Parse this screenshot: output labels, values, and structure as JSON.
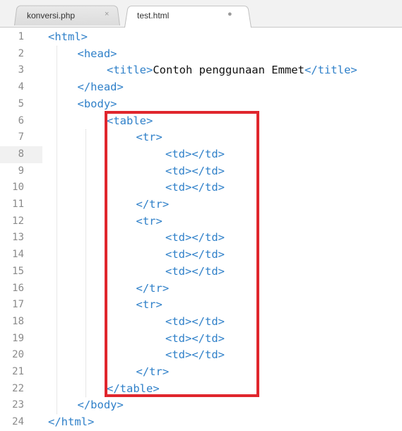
{
  "tabs": [
    {
      "label": "konversi.php",
      "control": "×",
      "active": false
    },
    {
      "label": "test.html",
      "control": "●",
      "active": true
    }
  ],
  "lines": [
    {
      "n": "1",
      "indent": 0,
      "code": "<html>",
      "text": ""
    },
    {
      "n": "2",
      "indent": 1,
      "code": "<head>",
      "text": ""
    },
    {
      "n": "3",
      "indent": 2,
      "code": "<title>",
      "text": "Contoh penggunaan Emmet",
      "close": "</title>"
    },
    {
      "n": "4",
      "indent": 1,
      "code": "</head>",
      "text": ""
    },
    {
      "n": "5",
      "indent": 1,
      "code": "<body>",
      "text": ""
    },
    {
      "n": "6",
      "indent": 2,
      "code": "<table>",
      "text": ""
    },
    {
      "n": "7",
      "indent": 3,
      "code": "<tr>",
      "text": ""
    },
    {
      "n": "8",
      "indent": 4,
      "code": "<td></td>",
      "text": ""
    },
    {
      "n": "9",
      "indent": 4,
      "code": "<td></td>",
      "text": ""
    },
    {
      "n": "10",
      "indent": 4,
      "code": "<td></td>",
      "text": ""
    },
    {
      "n": "11",
      "indent": 3,
      "code": "</tr>",
      "text": ""
    },
    {
      "n": "12",
      "indent": 3,
      "code": "<tr>",
      "text": ""
    },
    {
      "n": "13",
      "indent": 4,
      "code": "<td></td>",
      "text": ""
    },
    {
      "n": "14",
      "indent": 4,
      "code": "<td></td>",
      "text": ""
    },
    {
      "n": "15",
      "indent": 4,
      "code": "<td></td>",
      "text": ""
    },
    {
      "n": "16",
      "indent": 3,
      "code": "</tr>",
      "text": ""
    },
    {
      "n": "17",
      "indent": 3,
      "code": "<tr>",
      "text": ""
    },
    {
      "n": "18",
      "indent": 4,
      "code": "<td></td>",
      "text": ""
    },
    {
      "n": "19",
      "indent": 4,
      "code": "<td></td>",
      "text": ""
    },
    {
      "n": "20",
      "indent": 4,
      "code": "<td></td>",
      "text": ""
    },
    {
      "n": "21",
      "indent": 3,
      "code": "</tr>",
      "text": ""
    },
    {
      "n": "22",
      "indent": 2,
      "code": "</table>",
      "text": ""
    },
    {
      "n": "23",
      "indent": 1,
      "code": "</body>",
      "text": ""
    },
    {
      "n": "24",
      "indent": 0,
      "code": "</html>",
      "text": ""
    }
  ],
  "current_line": "8",
  "colors": {
    "tag": "#2f80c9",
    "highlight_box": "#e0262d"
  }
}
